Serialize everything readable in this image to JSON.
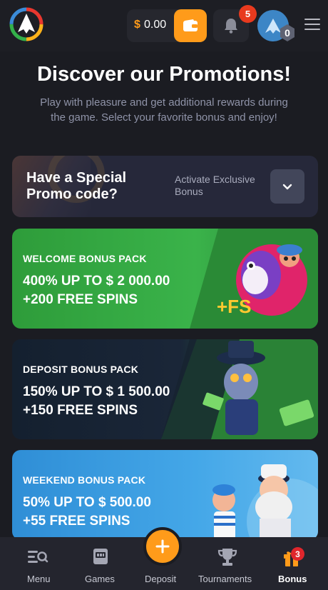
{
  "header": {
    "balance_currency": "$",
    "balance_value": "0.00",
    "notification_count": "5",
    "level": "0"
  },
  "page": {
    "title": "Discover our Promotions!",
    "subtitle": "Play with pleasure and get additional rewards during the game. Select your favorite bonus and enjoy!"
  },
  "promo": {
    "title": "Have a Special Promo code?",
    "hint": "Activate Exclusive Bonus"
  },
  "cards": [
    {
      "label": "WELCOME BONUS PACK",
      "line1": "400% UP TO $ 2 000.00",
      "line2": "+200 FREE SPINS",
      "art_text": "+FS"
    },
    {
      "label": "DEPOSIT BONUS PACK",
      "line1": "150% UP TO $ 1 500.00",
      "line2": "+150 FREE SPINS"
    },
    {
      "label": "WEEKEND BONUS PACK",
      "line1": "50% UP TO $ 500.00",
      "line2": "+55 FREE SPINS"
    }
  ],
  "nav": {
    "menu": "Menu",
    "games": "Games",
    "deposit": "Deposit",
    "tournaments": "Tournaments",
    "bonus": "Bonus",
    "bonus_count": "3"
  },
  "colors": {
    "accent": "#ff9b1a",
    "background": "#1b1c22",
    "badge_red": "#e83a1e"
  },
  "icons": [
    "logo-icon",
    "wallet-icon",
    "bell-icon",
    "avatar-icon",
    "menu-icon",
    "chevron-down-icon",
    "menu-search-icon",
    "games-icon",
    "plus-icon",
    "trophy-icon",
    "gift-icon"
  ]
}
